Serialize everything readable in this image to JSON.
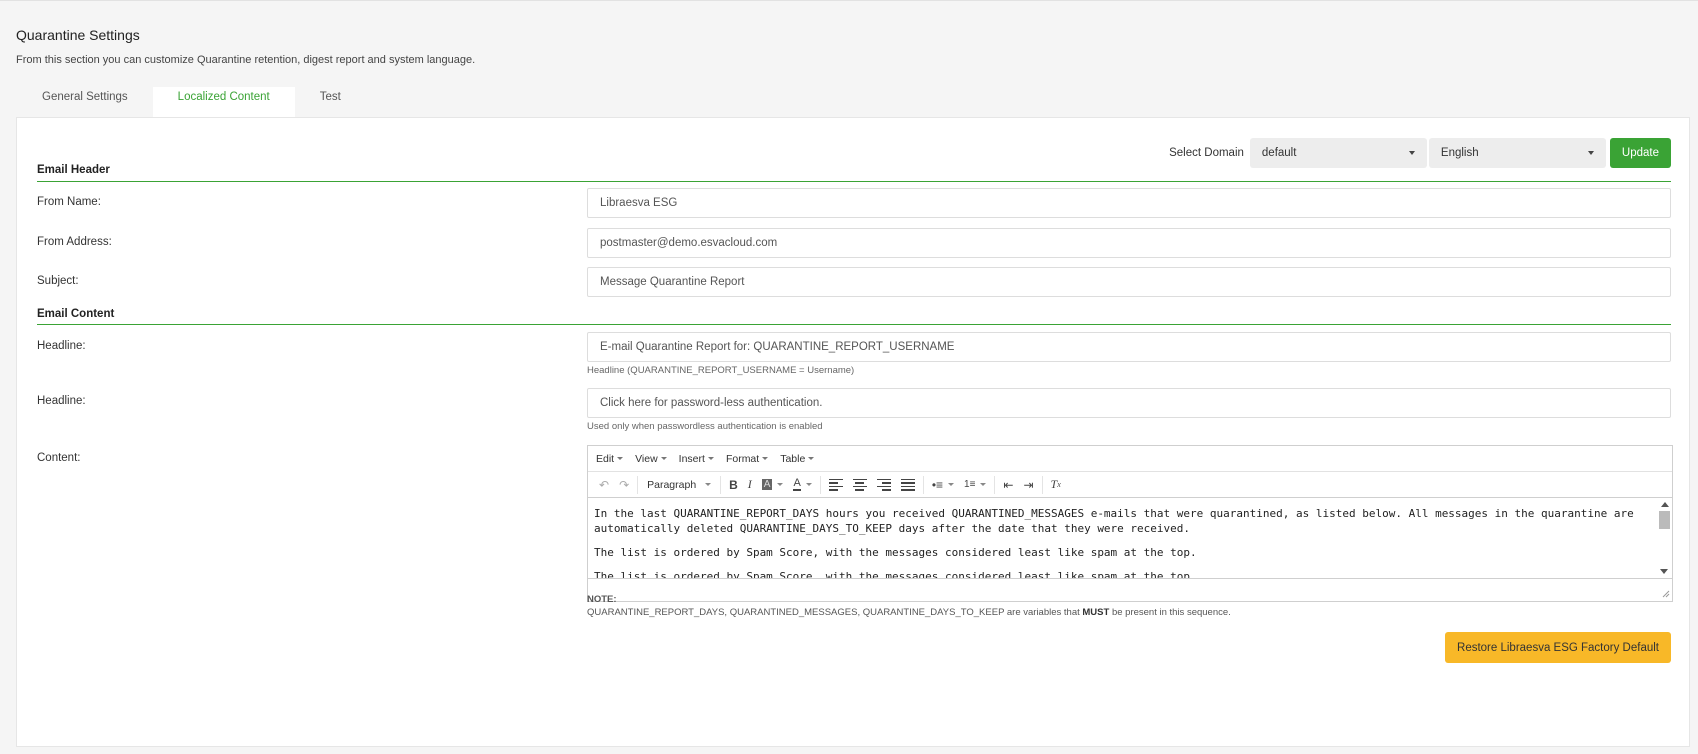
{
  "page": {
    "title": "Quarantine Settings",
    "description": "From this section you can customize Quarantine retention, digest report and system language."
  },
  "tabs": [
    {
      "label": "General Settings",
      "active": false
    },
    {
      "label": "Localized Content",
      "active": true
    },
    {
      "label": "Test",
      "active": false
    }
  ],
  "domain_bar": {
    "label": "Select Domain",
    "domain_value": "default",
    "language_value": "English",
    "update_label": "Update"
  },
  "email_header": {
    "title": "Email Header",
    "from_name_label": "From Name:",
    "from_name_value": "Libraesva ESG",
    "from_address_label": "From Address:",
    "from_address_value": "postmaster@demo.esvacloud.com",
    "subject_label": "Subject:",
    "subject_value": "Message Quarantine Report"
  },
  "email_content": {
    "title": "Email Content",
    "headline1_label": "Headline:",
    "headline1_value": "E-mail Quarantine Report for: QUARANTINE_REPORT_USERNAME",
    "headline1_help": "Headline (QUARANTINE_REPORT_USERNAME = Username)",
    "headline2_label": "Headline:",
    "headline2_value": "Click here for password-less authentication.",
    "headline2_help": "Used only when passwordless authentication is enabled",
    "content_label": "Content:"
  },
  "editor": {
    "menus": [
      "Edit",
      "View",
      "Insert",
      "Format",
      "Table"
    ],
    "block_format": "Paragraph",
    "paragraphs": [
      "In the last QUARANTINE_REPORT_DAYS hours you received QUARANTINED_MESSAGES e-mails that were quarantined, as listed below. All messages in the quarantine are automatically deleted QUARANTINE_DAYS_TO_KEEP days after the date that they were received.",
      "The list is ordered by Spam Score, with the messages considered least like spam at the top.",
      "The list is ordered by Spam Score, with the messages considered least like spam at the top."
    ]
  },
  "note": {
    "title": "NOTE:",
    "text_before": "QUARANTINE_REPORT_DAYS, QUARANTINED_MESSAGES, QUARANTINE_DAYS_TO_KEEP are variables that ",
    "emphasis": "MUST",
    "text_after": " be present in this sequence."
  },
  "restore_label": "Restore Libraesva ESG Factory Default",
  "colors": {
    "accent_green": "#3aa335",
    "restore_yellow": "#f8b828"
  }
}
